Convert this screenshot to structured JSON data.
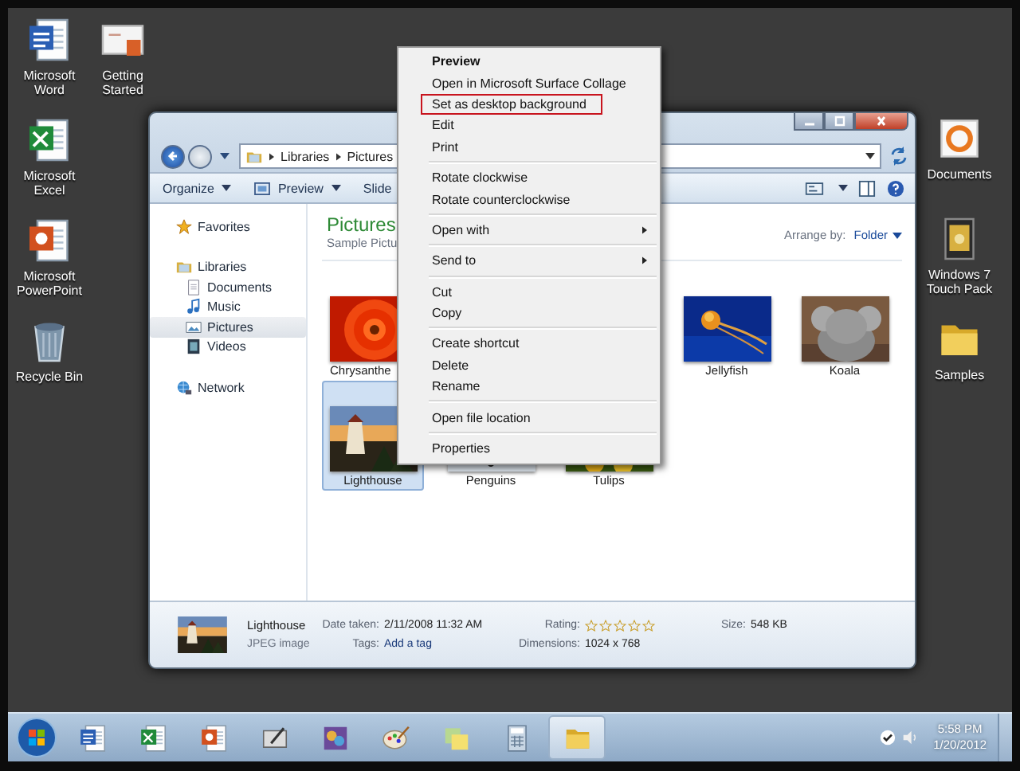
{
  "desktop": {
    "left_column": [
      {
        "label": "Microsoft Word",
        "kind": "word"
      },
      {
        "label": "Microsoft Excel",
        "kind": "excel"
      },
      {
        "label": "Microsoft PowerPoint",
        "kind": "powerpoint"
      },
      {
        "label": "Recycle Bin",
        "kind": "bin"
      }
    ],
    "second_column": [
      {
        "label": "Getting Started",
        "kind": "slides"
      }
    ],
    "right_column": [
      {
        "label": "Documents",
        "kind": "media"
      },
      {
        "label": "Windows 7 Touch Pack",
        "kind": "pack"
      },
      {
        "label": "Samples",
        "kind": "folder"
      }
    ]
  },
  "explorer": {
    "breadcrumb": [
      "Libraries",
      "Pictures"
    ],
    "toolbar": [
      {
        "label": "Organize",
        "kind": "menu"
      },
      {
        "label": "Preview",
        "kind": "preview"
      },
      {
        "label": "Slide",
        "kind": "plain"
      }
    ],
    "sidebar": [
      {
        "label": "Favorites",
        "kind": "star",
        "selected": false
      },
      {
        "label": "Libraries",
        "kind": "library",
        "selected": false,
        "children": [
          {
            "label": "Documents",
            "kind": "doc",
            "selected": false
          },
          {
            "label": "Music",
            "kind": "music",
            "selected": false
          },
          {
            "label": "Pictures",
            "kind": "pics",
            "selected": true
          },
          {
            "label": "Videos",
            "kind": "video",
            "selected": false
          }
        ]
      },
      {
        "label": "Network",
        "kind": "network",
        "selected": false
      }
    ],
    "title": "Pictures",
    "subtitle": "Sample Pictu",
    "arrange_label": "Arrange by:",
    "arrange_value": "Folder",
    "rows": [
      [
        {
          "label": "Chrysanthe",
          "selected": false
        },
        {
          "label": "Jellyfish",
          "selected": false
        },
        {
          "label": "Koala",
          "selected": false
        }
      ],
      [
        {
          "label": "Lighthouse",
          "selected": true
        },
        {
          "label": "Penguins",
          "selected": false
        },
        {
          "label": "Tulips",
          "selected": false
        }
      ]
    ],
    "details": {
      "name": "Lighthouse",
      "type": "JPEG image",
      "date_label": "Date taken:",
      "date_value": "2/11/2008 11:32 AM",
      "tags_label": "Tags:",
      "tags_value": "Add a tag",
      "rating_label": "Rating:",
      "stars": 0,
      "dimensions_label": "Dimensions:",
      "dimensions_value": "1024 x 768",
      "size_label": "Size:",
      "size_value": "548 KB"
    }
  },
  "context_menu": {
    "groups": [
      [
        {
          "label": "Preview",
          "kind": "default",
          "outlined": false
        },
        {
          "label": "Open in Microsoft Surface Collage",
          "kind": "plain",
          "outlined": false
        },
        {
          "label": "Set as desktop background",
          "kind": "plain",
          "outlined": true
        },
        {
          "label": "Edit",
          "kind": "plain",
          "outlined": false
        },
        {
          "label": "Print",
          "kind": "plain",
          "outlined": false
        }
      ],
      [
        {
          "label": "Rotate clockwise",
          "kind": "plain",
          "outlined": false
        },
        {
          "label": "Rotate counterclockwise",
          "kind": "plain",
          "outlined": false
        }
      ],
      [
        {
          "label": "Open with",
          "kind": "submenu",
          "outlined": false
        }
      ],
      [
        {
          "label": "Send to",
          "kind": "submenu",
          "outlined": false
        }
      ],
      [
        {
          "label": "Cut",
          "kind": "plain",
          "outlined": false
        },
        {
          "label": "Copy",
          "kind": "plain",
          "outlined": false
        }
      ],
      [
        {
          "label": "Create shortcut",
          "kind": "plain",
          "outlined": false
        },
        {
          "label": "Delete",
          "kind": "plain",
          "outlined": false
        },
        {
          "label": "Rename",
          "kind": "plain",
          "outlined": false
        }
      ],
      [
        {
          "label": "Open file location",
          "kind": "plain",
          "outlined": false
        }
      ],
      [
        {
          "label": "Properties",
          "kind": "plain",
          "outlined": false
        }
      ]
    ]
  },
  "taskbar": {
    "apps": [
      {
        "kind": "word",
        "selected": false
      },
      {
        "kind": "excel",
        "selected": false
      },
      {
        "kind": "powerpoint",
        "selected": false
      },
      {
        "kind": "pen",
        "selected": false
      },
      {
        "kind": "gallery",
        "selected": false
      },
      {
        "kind": "paint",
        "selected": false
      },
      {
        "kind": "notes",
        "selected": false
      },
      {
        "kind": "calc",
        "selected": false
      },
      {
        "kind": "folder",
        "selected": true
      }
    ],
    "time": "5:58 PM",
    "date": "1/20/2012"
  }
}
